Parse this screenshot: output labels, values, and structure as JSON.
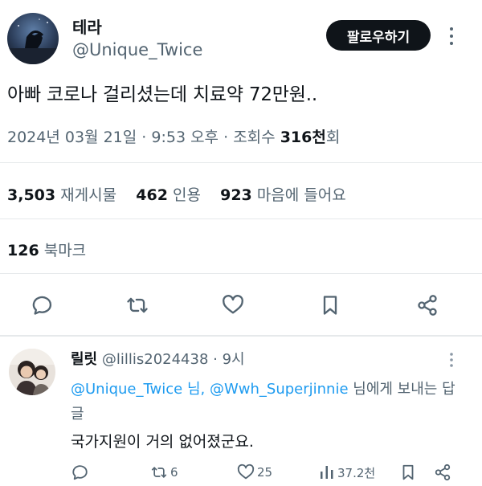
{
  "main_tweet": {
    "author_name": "테라",
    "author_handle": "@Unique_Twice",
    "follow_label": "팔로우하기",
    "text": "아빠 코로나 걸리셨는데 치료약 72만원..",
    "date": "2024년 03월 21일",
    "time": "9:53 오후",
    "views_label": "조회수",
    "views_value": "316천",
    "views_suffix": "회",
    "retweets_count": "3,503",
    "retweets_label": "재게시물",
    "quotes_count": "462",
    "quotes_label": "인용",
    "likes_count": "923",
    "likes_label": "마음에 들어요",
    "bookmarks_count": "126",
    "bookmarks_label": "북마크"
  },
  "reply": {
    "author_name": "릴릿",
    "author_handle": "@lillis2024438",
    "time": "9시",
    "mention1": "@Unique_Twice",
    "connector": "님,",
    "mention2": "@Wwh_Superjinnie",
    "replying_suffix": "님에게 보내는 답글",
    "text": "국가지원이 거의 없어졌군요.",
    "retweet_count": "6",
    "like_count": "25",
    "views_count": "37.2천"
  },
  "icons": {
    "reply": "reply-icon",
    "retweet": "retweet-icon",
    "like": "heart-icon",
    "bookmark": "bookmark-icon",
    "share": "share-icon",
    "views": "views-icon",
    "more": "more-icon"
  },
  "colors": {
    "text": "#0f1419",
    "secondary": "#536471",
    "link": "#1d9bf0",
    "follow_bg": "#0f1419"
  }
}
